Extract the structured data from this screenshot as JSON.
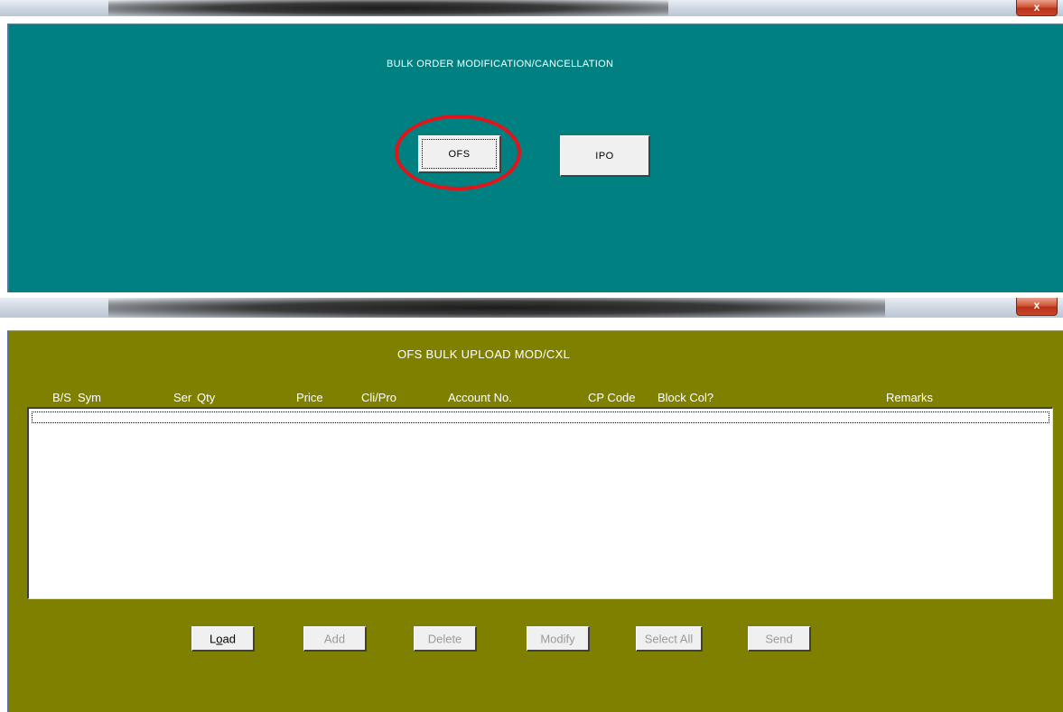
{
  "window1": {
    "close_label": "x",
    "title": "BULK ORDER MODIFICATION/CANCELLATION",
    "buttons": {
      "ofs": "OFS",
      "ipo": "IPO"
    },
    "highlight_color": "#e2141a",
    "background": "#008080"
  },
  "window2": {
    "close_label": "x",
    "title": "OFS BULK UPLOAD MOD/CXL",
    "background": "#808000",
    "columns": [
      "B/S",
      "Sym",
      "Ser",
      "Qty",
      "Price",
      "Cli/Pro",
      "Account No.",
      "CP Code",
      "Block Col?",
      "Remarks"
    ],
    "buttons": {
      "load_prefix": "L",
      "load_underlined": "o",
      "load_suffix": "ad",
      "add": "Add",
      "delete": "Delete",
      "modify": "Modify",
      "select_all": "Select All",
      "send": "Send"
    }
  }
}
